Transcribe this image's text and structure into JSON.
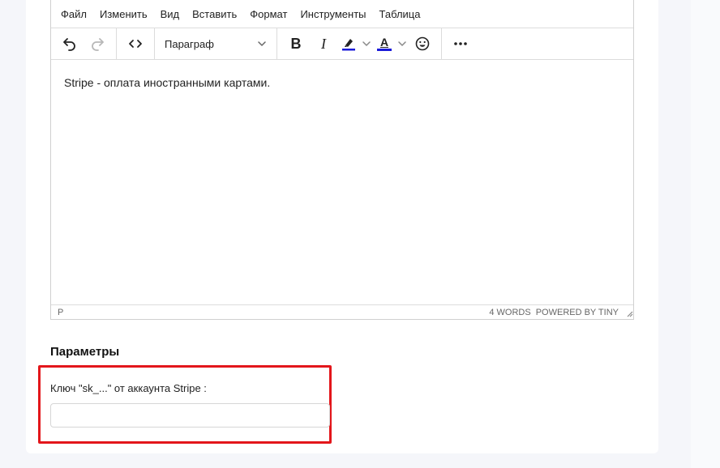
{
  "menubar": {
    "items": [
      "Файл",
      "Изменить",
      "Вид",
      "Вставить",
      "Формат",
      "Инструменты",
      "Таблица"
    ]
  },
  "toolbar": {
    "block_format": "Параграф",
    "icons": [
      "undo-icon",
      "redo-icon",
      "source-code-icon",
      "chevron-down-icon",
      "bold-icon",
      "italic-icon",
      "highlight-icon",
      "text-color-icon",
      "emoji-icon",
      "more-icon"
    ],
    "bold_glyph": "B",
    "italic_glyph": "I",
    "text_color_glyph": "A",
    "highlight_color": "#1b1bd8",
    "text_color": "#1b1bd8"
  },
  "editor": {
    "content": "Stripe - оплата иностранными картами.",
    "status_path": "P",
    "word_count": "4 WORDS",
    "powered_by": "POWERED BY TINY"
  },
  "params": {
    "section_title": "Параметры",
    "stripe_key_label": "Ключ \"sk_...\" от аккаунта Stripe :",
    "stripe_key_value": ""
  },
  "colors": {
    "highlight_border": "#e3161b"
  }
}
